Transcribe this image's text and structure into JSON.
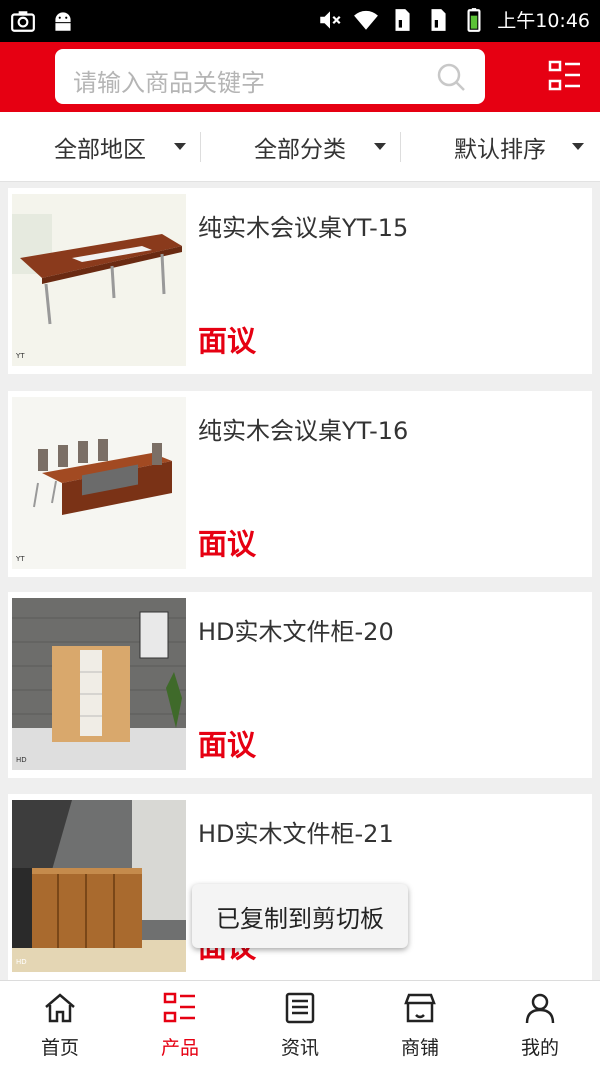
{
  "status_bar": {
    "time": "上午10:46",
    "icons": [
      "camera-icon",
      "android-icon",
      "mute-icon",
      "wifi-icon",
      "sim1-icon",
      "sim2-icon",
      "battery-icon"
    ]
  },
  "header": {
    "search_placeholder": "请输入商品关键字",
    "accent_color": "#e60012"
  },
  "filters": [
    {
      "label": "全部地区"
    },
    {
      "label": "全部分类"
    },
    {
      "label": "默认排序"
    }
  ],
  "products": [
    {
      "name": "纯实木会议桌YT-15",
      "price": "面议",
      "image": "conference-table"
    },
    {
      "name": "纯实木会议桌YT-16",
      "price": "面议",
      "image": "conference-table-chairs"
    },
    {
      "name": "HD实木文件柜-20",
      "price": "面议",
      "image": "file-cabinet"
    },
    {
      "name": "HD实木文件柜-21",
      "price": "面议",
      "image": "sideboard-cabinet"
    }
  ],
  "toast": {
    "text": "已复制到剪切板"
  },
  "tabs": [
    {
      "label": "首页",
      "icon": "home-icon"
    },
    {
      "label": "产品",
      "icon": "product-list-icon",
      "active": true
    },
    {
      "label": "资讯",
      "icon": "news-icon"
    },
    {
      "label": "商铺",
      "icon": "shop-icon"
    },
    {
      "label": "我的",
      "icon": "user-icon"
    }
  ]
}
